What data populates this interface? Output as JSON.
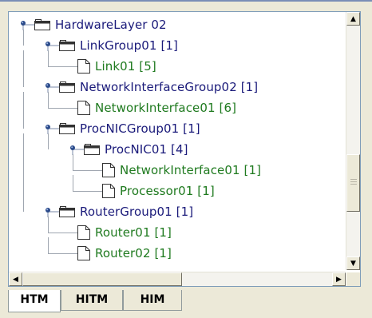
{
  "tree": {
    "nodes": [
      {
        "label": "HardwareLayer 02",
        "type": "folder",
        "depth": 0,
        "expanded": true
      },
      {
        "label": "LinkGroup01 [1]",
        "type": "folder",
        "depth": 1,
        "expanded": true
      },
      {
        "label": "Link01 [5]",
        "type": "leaf",
        "depth": 2
      },
      {
        "label": "NetworkInterfaceGroup02 [1]",
        "type": "folder",
        "depth": 1,
        "expanded": true
      },
      {
        "label": "NetworkInterface01 [6]",
        "type": "leaf",
        "depth": 2
      },
      {
        "label": "ProcNICGroup01 [1]",
        "type": "folder",
        "depth": 1,
        "expanded": true
      },
      {
        "label": "ProcNIC01 [4]",
        "type": "folder",
        "depth": 2,
        "expanded": true
      },
      {
        "label": "NetworkInterface01 [1]",
        "type": "leaf",
        "depth": 3
      },
      {
        "label": "Processor01 [1]",
        "type": "leaf",
        "depth": 3
      },
      {
        "label": "RouterGroup01 [1]",
        "type": "folder",
        "depth": 1,
        "expanded": true
      },
      {
        "label": "Router01 [1]",
        "type": "leaf",
        "depth": 2
      },
      {
        "label": "Router02 [1]",
        "type": "leaf",
        "depth": 2
      }
    ]
  },
  "scrollbars": {
    "up_arrow": "▲",
    "down_arrow": "▼",
    "left_arrow": "◀",
    "right_arrow": "▶"
  },
  "tabs": [
    {
      "label": "HTM",
      "active": true
    },
    {
      "label": "HITM",
      "active": false
    },
    {
      "label": "HIM",
      "active": false
    }
  ],
  "colors": {
    "folder_label": "#1a1a7a",
    "leaf_label": "#1f7a1f",
    "panel_border": "#7f9db9",
    "chrome": "#ece9d8"
  },
  "icons": {
    "folder": "folder-icon",
    "leaf": "document-icon",
    "handle": "tree-handle-icon"
  }
}
